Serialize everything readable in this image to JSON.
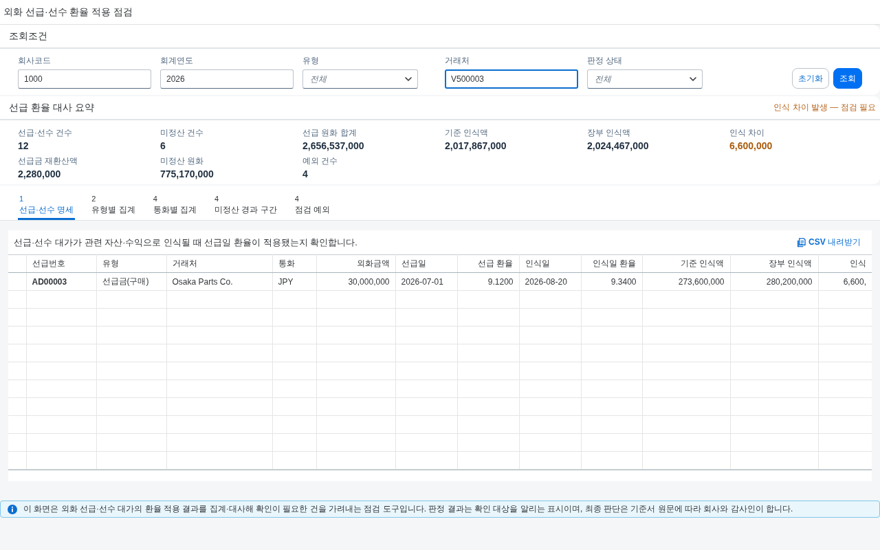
{
  "page": {
    "title": "외화 선급·선수 환율 적용 점검"
  },
  "filters": {
    "title": "조회조건",
    "fields": [
      {
        "label": "회사코드",
        "kind": "input",
        "value": "1000",
        "focused": false
      },
      {
        "label": "회계연도",
        "kind": "input",
        "value": "2026",
        "focused": false
      },
      {
        "label": "유형",
        "kind": "select",
        "placeholder": "전체",
        "focused": false
      },
      {
        "label": "거래처",
        "kind": "input",
        "value": "V500003",
        "focused": true
      },
      {
        "label": "판정 상태",
        "kind": "select",
        "placeholder": "전체",
        "focused": false
      }
    ],
    "buttons": [
      {
        "label": "초기화",
        "kind": "default"
      },
      {
        "label": "조회",
        "kind": "primary"
      }
    ]
  },
  "summary": {
    "title": "선급 환율 대사 요약",
    "status": {
      "text": "인식 차이 발생 — 점검 필요",
      "kind": "warning"
    },
    "metrics": [
      {
        "label": "선급·선수 건수",
        "value": "12",
        "kind": "normal"
      },
      {
        "label": "미정산 건수",
        "value": "6",
        "kind": "normal"
      },
      {
        "label": "선급 원화 합계",
        "value": "2,656,537,000",
        "kind": "normal"
      },
      {
        "label": "기준 인식액",
        "value": "2,017,867,000",
        "kind": "normal"
      },
      {
        "label": "장부 인식액",
        "value": "2,024,467,000",
        "kind": "normal"
      },
      {
        "label": "인식 차이",
        "value": "6,600,000",
        "kind": "warning"
      },
      {
        "label": "선급금 재환산액",
        "value": "2,280,000",
        "kind": "normal"
      },
      {
        "label": "미정산 원화",
        "value": "775,170,000",
        "kind": "normal"
      },
      {
        "label": "예외 건수",
        "value": "4",
        "kind": "normal"
      }
    ]
  },
  "tabs": [
    {
      "count": "1",
      "label": "선급·선수 명세",
      "selected": true
    },
    {
      "count": "2",
      "label": "유형별 집계",
      "selected": false
    },
    {
      "count": "4",
      "label": "통화별 집계",
      "selected": false
    },
    {
      "count": "4",
      "label": "미정산 경과 구간",
      "selected": false
    },
    {
      "count": "4",
      "label": "점검 예외",
      "selected": false
    }
  ],
  "detail": {
    "description": "선급·선수 대가가 관련 자산·수익으로 인식될 때 선급일 환율이 적용됐는지 확인합니다.",
    "export_button": "**CSV** 내려받기",
    "table": {
      "columns": [
        {
          "label": "선급번호",
          "kind": "text"
        },
        {
          "label": "유형",
          "kind": "text"
        },
        {
          "label": "거래처",
          "kind": "text"
        },
        {
          "label": "통화",
          "kind": "text"
        },
        {
          "label": "외화금액",
          "kind": "number"
        },
        {
          "label": "선급일",
          "kind": "text"
        },
        {
          "label": "선급 환율",
          "kind": "number"
        },
        {
          "label": "인식일",
          "kind": "text"
        },
        {
          "label": "인식일 환율",
          "kind": "number"
        },
        {
          "label": "기준 인식액",
          "kind": "number"
        },
        {
          "label": "장부 인식액",
          "kind": "number"
        },
        {
          "label": "인식",
          "kind": "number"
        }
      ],
      "rows": [
        {
          "cells": [
            "AD00003",
            "선급금(구매)",
            "Osaka Parts Co.",
            "JPY",
            "30,000,000",
            "2026-07-01",
            "9.1200",
            "2026-08-20",
            "9.3400",
            "273,600,000",
            "280,200,000",
            "6,600,"
          ]
        }
      ]
    }
  },
  "info_message": {
    "text": "이 화면은 외화 선급·선수 대가의 환율 적용 결과를 집계·대사해 확인이 필요한 건을 가려내는 점검 도구입니다. 판정 결과는 확인 대상을 알리는 표시이며, 최종 판단은 기준서 원문에 따라 회사와 감사인이 합니다."
  }
}
